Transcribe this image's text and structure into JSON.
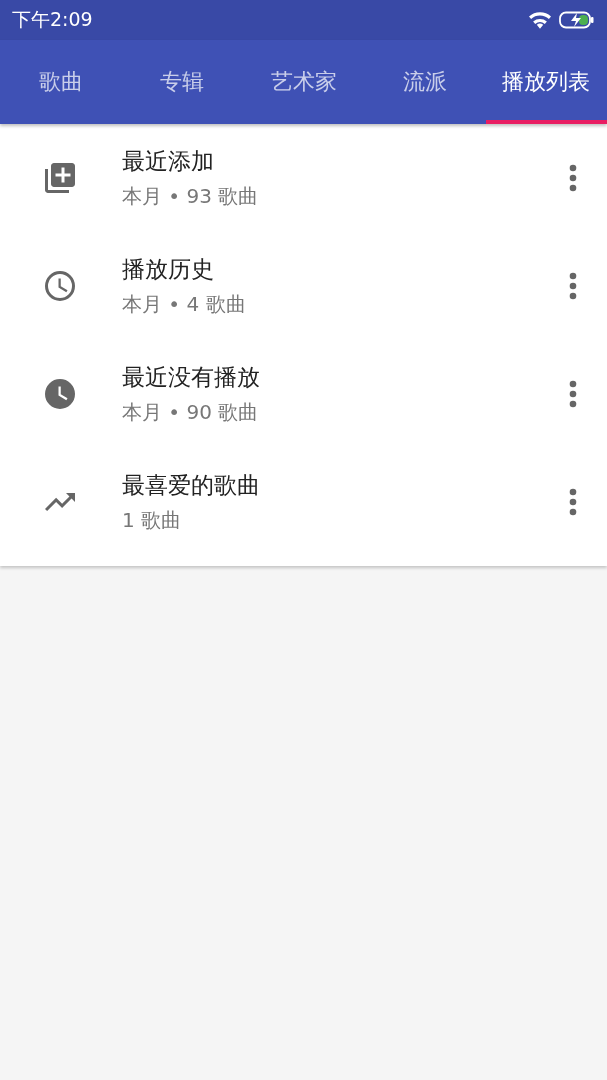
{
  "status_bar": {
    "time": "下午2:09"
  },
  "tabs": [
    {
      "label": "歌曲",
      "selected": false
    },
    {
      "label": "专辑",
      "selected": false
    },
    {
      "label": "艺术家",
      "selected": false
    },
    {
      "label": "流派",
      "selected": false
    },
    {
      "label": "播放列表",
      "selected": true
    }
  ],
  "playlists": [
    {
      "kind": "add",
      "title": "最近添加",
      "subtitle": "本月 • 93 歌曲"
    },
    {
      "kind": "history",
      "title": "播放历史",
      "subtitle": "本月 • 4 歌曲"
    },
    {
      "kind": "clock",
      "title": "最近没有播放",
      "subtitle": "本月 • 90 歌曲"
    },
    {
      "kind": "trend",
      "title": "最喜爱的歌曲",
      "subtitle": "1 歌曲"
    }
  ]
}
